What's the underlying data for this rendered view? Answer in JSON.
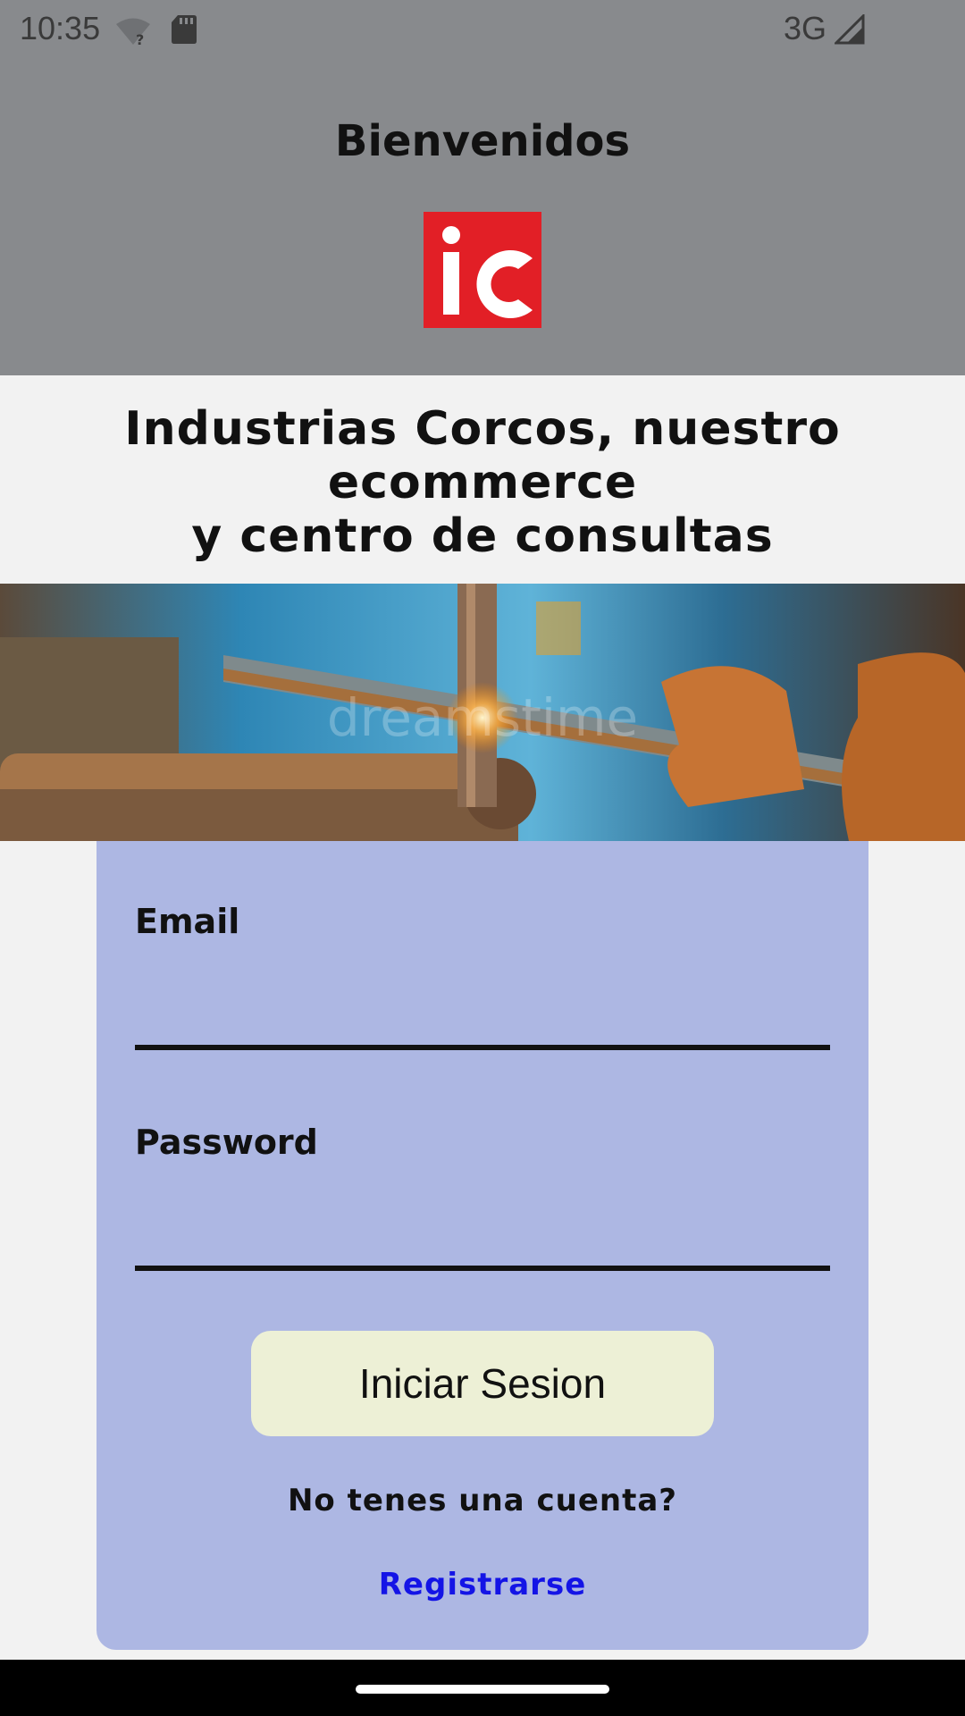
{
  "status_bar": {
    "time": "10:35",
    "network": "3G",
    "wifi_icon": "wifi-unknown-icon",
    "sd_icon": "sd-card-icon",
    "signal_icon": "cell-signal-icon"
  },
  "header": {
    "welcome": "Bienvenidos",
    "logo_text": "iC",
    "logo_color": "#e21f26"
  },
  "tagline": {
    "line1": "Industrias Corcos, nuestro ecommerce",
    "line2": "y centro de consultas"
  },
  "banner": {
    "watermark": "dreamstime"
  },
  "login": {
    "email_label": "Email",
    "email_value": "",
    "password_label": "Password",
    "password_value": "",
    "submit_label": "Iniciar Sesion",
    "no_account_text": "No tenes una cuenta?",
    "register_link": "Registrarse",
    "card_color": "#adb7e3",
    "button_color": "#edf0d6",
    "link_color": "#1414e6"
  }
}
